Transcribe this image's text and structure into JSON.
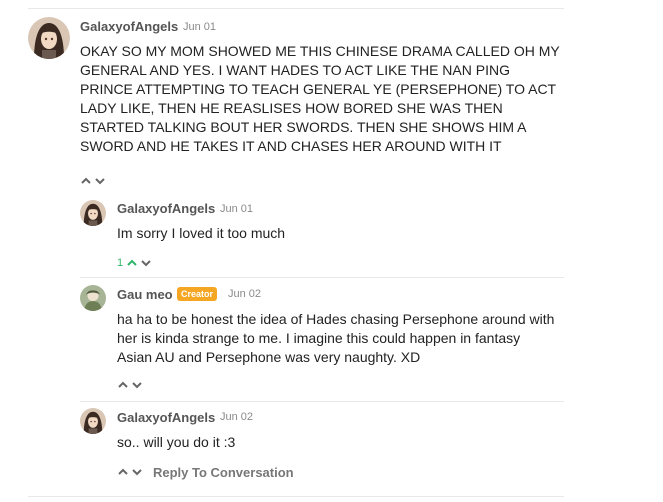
{
  "comments": [
    {
      "author": "GalaxyofAngels",
      "date": "Jun 01",
      "text": "OKAY SO MY MOM SHOWED ME THIS CHINESE DRAMA CALLED OH MY GENERAL AND YES. I WANT HADES TO ACT LIKE THE NAN PING PRINCE ATTEMPTING TO TEACH GENERAL YE (PERSEPHONE) TO ACT LADY LIKE, THEN HE REASLISES HOW BORED SHE WAS THEN STARTED TALKING BOUT HER SWORDS. THEN SHE SHOWS HIM A SWORD AND HE TAKES IT AND CHASES HER AROUND WITH IT",
      "avatar_icon": "anime-girl-avatar"
    },
    {
      "author": "GalaxyofAngels",
      "date": "Jun 01",
      "text": "Im sorry I loved it too much",
      "upvotes": "1",
      "upvote_color": "#2fb66a",
      "avatar_icon": "anime-girl-avatar"
    },
    {
      "author": "Gau meo",
      "badge": "Creator",
      "badge_color": "#f5a623",
      "date": "Jun 02",
      "text": "ha ha to be honest the idea of Hades chasing Persephone around with her is kinda strange to me. I imagine this could happen in fantasy Asian AU and Persephone was very naughty. XD",
      "avatar_icon": "creator-avatar"
    },
    {
      "author": "GalaxyofAngels",
      "date": "Jun 02",
      "text": "so.. will you do it :3",
      "avatar_icon": "anime-girl-avatar"
    }
  ],
  "reply_link": "Reply To Conversation"
}
